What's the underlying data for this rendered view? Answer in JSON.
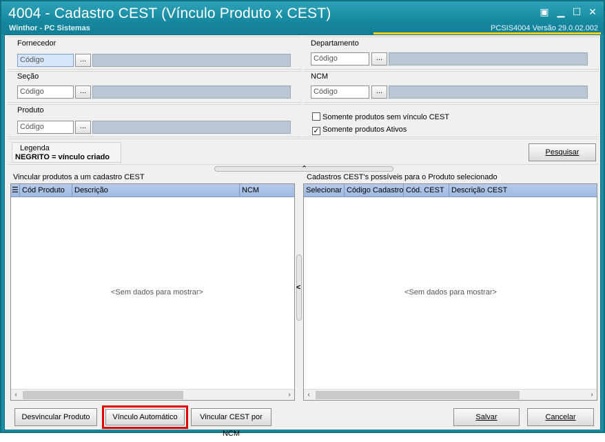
{
  "window": {
    "title": "4004 - Cadastro CEST (Vínculo Produto x CEST)",
    "subtitle": "Winthor - PC Sistemas",
    "version": "PCSIS4004  Versão  29.0.02.002",
    "controls": {
      "restore": "▣",
      "minimize": "▁",
      "maximize": "☐",
      "close": "✕"
    }
  },
  "filters": {
    "fornecedor": {
      "label": "Fornecedor",
      "placeholder": "Código",
      "ellipsis": "..."
    },
    "departamento": {
      "label": "Departamento",
      "placeholder": "Código",
      "ellipsis": "..."
    },
    "secao": {
      "label": "Seção",
      "placeholder": "Código",
      "ellipsis": "..."
    },
    "ncm": {
      "label": "NCM",
      "placeholder": "Código",
      "ellipsis": "..."
    },
    "produto": {
      "label": "Produto",
      "placeholder": "Código",
      "ellipsis": "..."
    },
    "chk_sem_vinculo": {
      "label": "Somente produtos sem vínculo CEST",
      "checked": false
    },
    "chk_ativos": {
      "label": "Somente produtos Ativos",
      "checked": true,
      "mark": "✓"
    }
  },
  "legend": {
    "title": "Legenda",
    "text": "NEGRITO = vínculo criado"
  },
  "buttons": {
    "pesquisar": "Pesquisar",
    "desvincular": "Desvincular Produto",
    "vinculo_auto": "Vínculo Automático",
    "vincular_ncm": "Vincular CEST por NCM",
    "salvar": "Salvar",
    "cancelar": "Cancelar"
  },
  "left_grid": {
    "title": "Vincular produtos a um cadastro CEST",
    "columns": [
      "Cód Produto",
      "Descrição",
      "NCM"
    ],
    "empty": "<Sem dados para mostrar>"
  },
  "right_grid": {
    "title": "Cadastros CEST's possíveis para o Produto selecionado",
    "columns": [
      "Selecionar",
      "Código Cadastro",
      "Cód. CEST",
      "Descrição CEST"
    ],
    "empty": "<Sem dados para mostrar>"
  },
  "icons": {
    "grid_menu": "☰",
    "arrow_left": "‹",
    "arrow_right": "›",
    "collapse_up": "⌃",
    "collapse_left": "<"
  }
}
